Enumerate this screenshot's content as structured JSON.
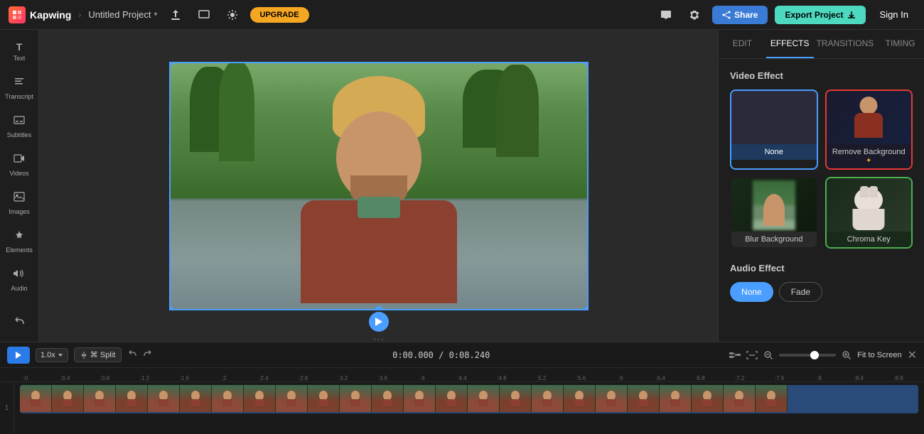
{
  "app": {
    "logo_text": "K",
    "brand": "Kapwing",
    "project_name": "Untitled Project",
    "chevron": "›"
  },
  "topbar": {
    "upgrade_label": "UPGRADE",
    "share_label": "Share",
    "export_label": "Export Project",
    "signin_label": "Sign In"
  },
  "sidebar": {
    "items": [
      {
        "id": "text",
        "icon": "T",
        "label": "Text"
      },
      {
        "id": "transcript",
        "icon": "≡",
        "label": "Transcript"
      },
      {
        "id": "subtitles",
        "icon": "⬜",
        "label": "Subtitles"
      },
      {
        "id": "videos",
        "icon": "▶",
        "label": "Videos"
      },
      {
        "id": "images",
        "icon": "🖼",
        "label": "Images"
      },
      {
        "id": "elements",
        "icon": "✦",
        "label": "Elements"
      },
      {
        "id": "audio",
        "icon": "♪",
        "label": "Audio"
      }
    ]
  },
  "right_panel": {
    "tabs": [
      {
        "id": "edit",
        "label": "EDIT"
      },
      {
        "id": "effects",
        "label": "EFFECTS",
        "active": true
      },
      {
        "id": "transitions",
        "label": "TRANSITIONS"
      },
      {
        "id": "timing",
        "label": "TIMING"
      }
    ],
    "video_effect_title": "Video Effect",
    "effects": [
      {
        "id": "none",
        "label": "None",
        "selected": "blue"
      },
      {
        "id": "remove_bg",
        "label": "Remove Background",
        "has_sparkle": true,
        "selected": "red"
      },
      {
        "id": "blur_bg",
        "label": "Blur Background",
        "selected": "none"
      },
      {
        "id": "chroma_key",
        "label": "Chroma Key",
        "selected": "green"
      }
    ],
    "audio_effect_title": "Audio Effect",
    "audio_buttons": [
      {
        "id": "none",
        "label": "None",
        "active": true
      },
      {
        "id": "fade",
        "label": "Fade",
        "active": false
      }
    ]
  },
  "timeline": {
    "play_label": "▶",
    "speed_label": "1.0x",
    "split_label": "⌘ Split",
    "time_current": "0:00.000",
    "time_total": "0:08.240",
    "time_display": "0:00.000 / 0:08.240",
    "fit_screen_label": "Fit to Screen",
    "ruler_marks": [
      ":0",
      ":0.4",
      ":0.8",
      ":1.2",
      ":1.6",
      ":2",
      ":2.4",
      ":2.8",
      ":3.2",
      ":3.6",
      ":4",
      ":4.4",
      ":4.8",
      ":5.2",
      ":5.6",
      ":6",
      ":6.4",
      ":6.8",
      ":7.2",
      ":7.6",
      ":8",
      ":8.4",
      ":8.8"
    ],
    "track_number": "1"
  }
}
